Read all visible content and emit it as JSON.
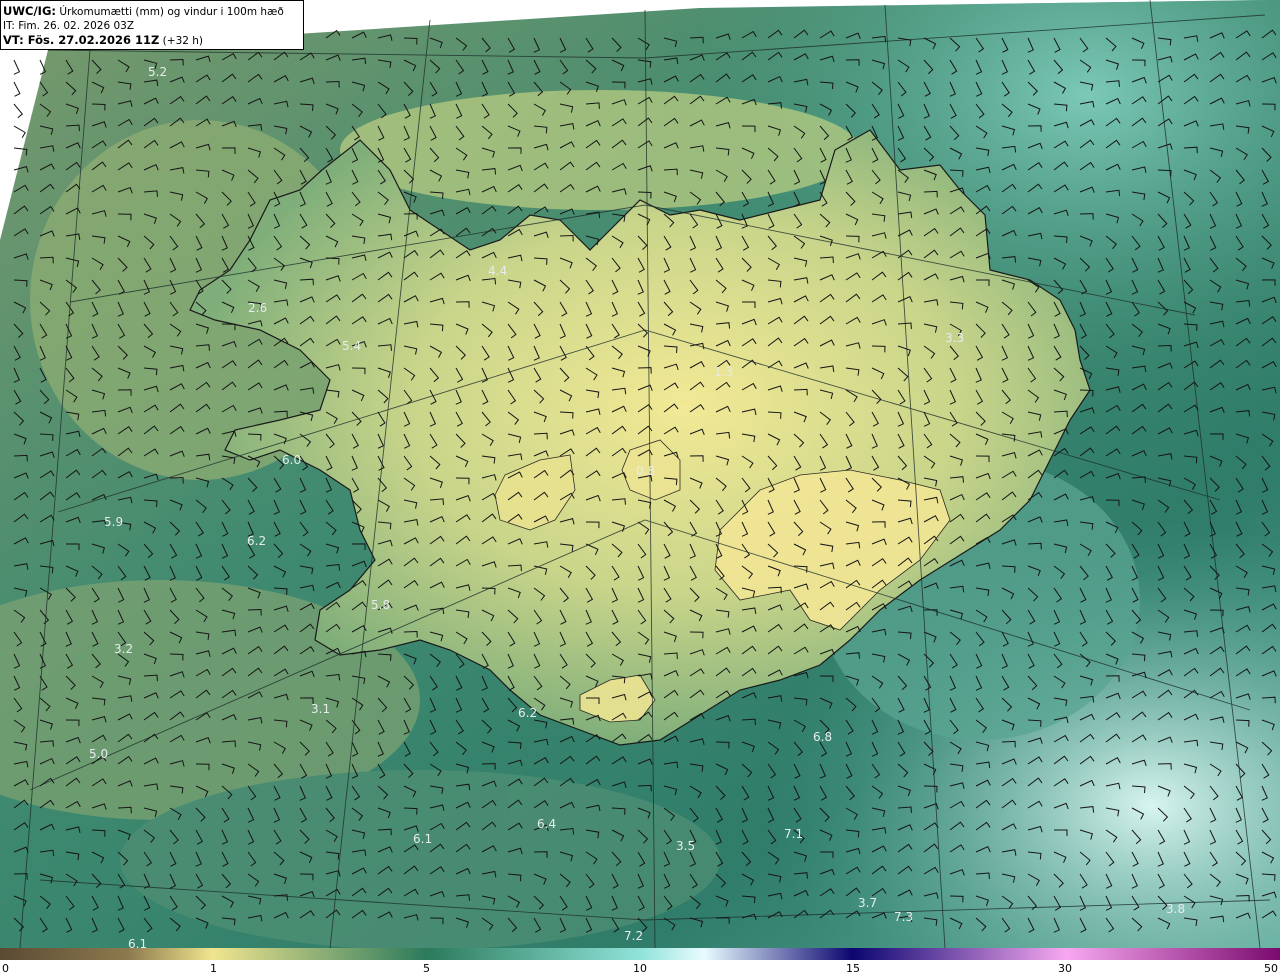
{
  "header": {
    "model": "UWC/IG:",
    "title": "Úrkomumætti (mm) og vindur i 100m hæð",
    "init_time": "IT: Fim. 26. 02. 2026 03Z",
    "valid_label": "VT: Fös. 27.02.2026 11Z",
    "lead": "(+32 h)"
  },
  "colorbar": {
    "ticks": [
      "0",
      "1",
      "5",
      "10",
      "15",
      "30",
      "50"
    ],
    "colors": [
      "#5b4a33",
      "#8c7a4e",
      "#f0e58f",
      "#2c7a5c",
      "#8fe3d8",
      "#e8fbff",
      "#0b0670",
      "#f7a8f0",
      "#7a0a6e"
    ]
  },
  "values": [
    "5.2",
    "4.4",
    "2.6",
    "5.4",
    "6.0",
    "5.9",
    "6.2",
    "5.8",
    "3.2",
    "3.1",
    "5.0",
    "6.2",
    "6.8",
    "6.4",
    "6.1",
    "3.5",
    "7.1",
    "3.7",
    "7.3",
    "7.2",
    "6.1",
    "3.8",
    "0.8",
    "3.3",
    "1.3"
  ]
}
